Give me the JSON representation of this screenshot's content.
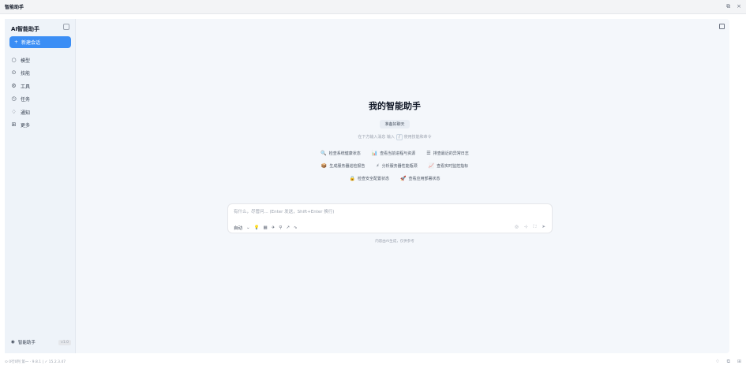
{
  "window": {
    "title": "智能助手",
    "controls": [
      "⧉",
      "×"
    ]
  },
  "sidebar": {
    "brand": "AI智能助手",
    "new_chat": "新建会话",
    "items": [
      {
        "label": "模型",
        "icon": "○"
      },
      {
        "label": "技能",
        "icon": "⊙"
      },
      {
        "label": "工具",
        "icon": "⚙"
      },
      {
        "label": "任务",
        "icon": "◷"
      },
      {
        "label": "通知",
        "icon": "♢"
      },
      {
        "label": "更多",
        "icon": "⊞"
      }
    ],
    "footer": {
      "label": "智能助手",
      "version": "v1.0"
    }
  },
  "main": {
    "title": "我的智能助手",
    "badge": "准备好聊天",
    "hint_pre": "在下方输入消息 输入",
    "hint_key": "/",
    "hint_post": "使用技能和命令",
    "chips": [
      [
        {
          "icon": "🔍",
          "label": "检查系统健康状态"
        },
        {
          "icon": "📊",
          "label": "查看当前进程与资源"
        },
        {
          "icon": "☰",
          "label": "排查最近的异常日志"
        }
      ],
      [
        {
          "icon": "📦",
          "label": "生成服务器巡检报告"
        },
        {
          "icon": "⚡",
          "label": "分析服务器性能瓶颈"
        },
        {
          "icon": "📈",
          "label": "查看实时监控指标"
        }
      ],
      [
        {
          "icon": "🔒",
          "label": "检查安全配置状态"
        },
        {
          "icon": "🚀",
          "label": "查看应用部署状态"
        }
      ]
    ],
    "composer": {
      "placeholder": "有什么，尽管问... (Enter 发送，Shift+Enter 换行)",
      "mode": "自动",
      "tools": [
        "⌄",
        "💡",
        "▦",
        "✈",
        "⚲",
        "↗",
        "∿"
      ],
      "actions": [
        "◎",
        "⊹",
        "⛶",
        "➤"
      ]
    },
    "disclaimer": "内容由AI生成，仅供参考"
  },
  "statusbar": {
    "left": "⊙ 0行0列  第一 · 9.8.1  |  ✓ 15.2.3.47",
    "right": [
      "♢",
      "⧉",
      "⊞"
    ]
  }
}
